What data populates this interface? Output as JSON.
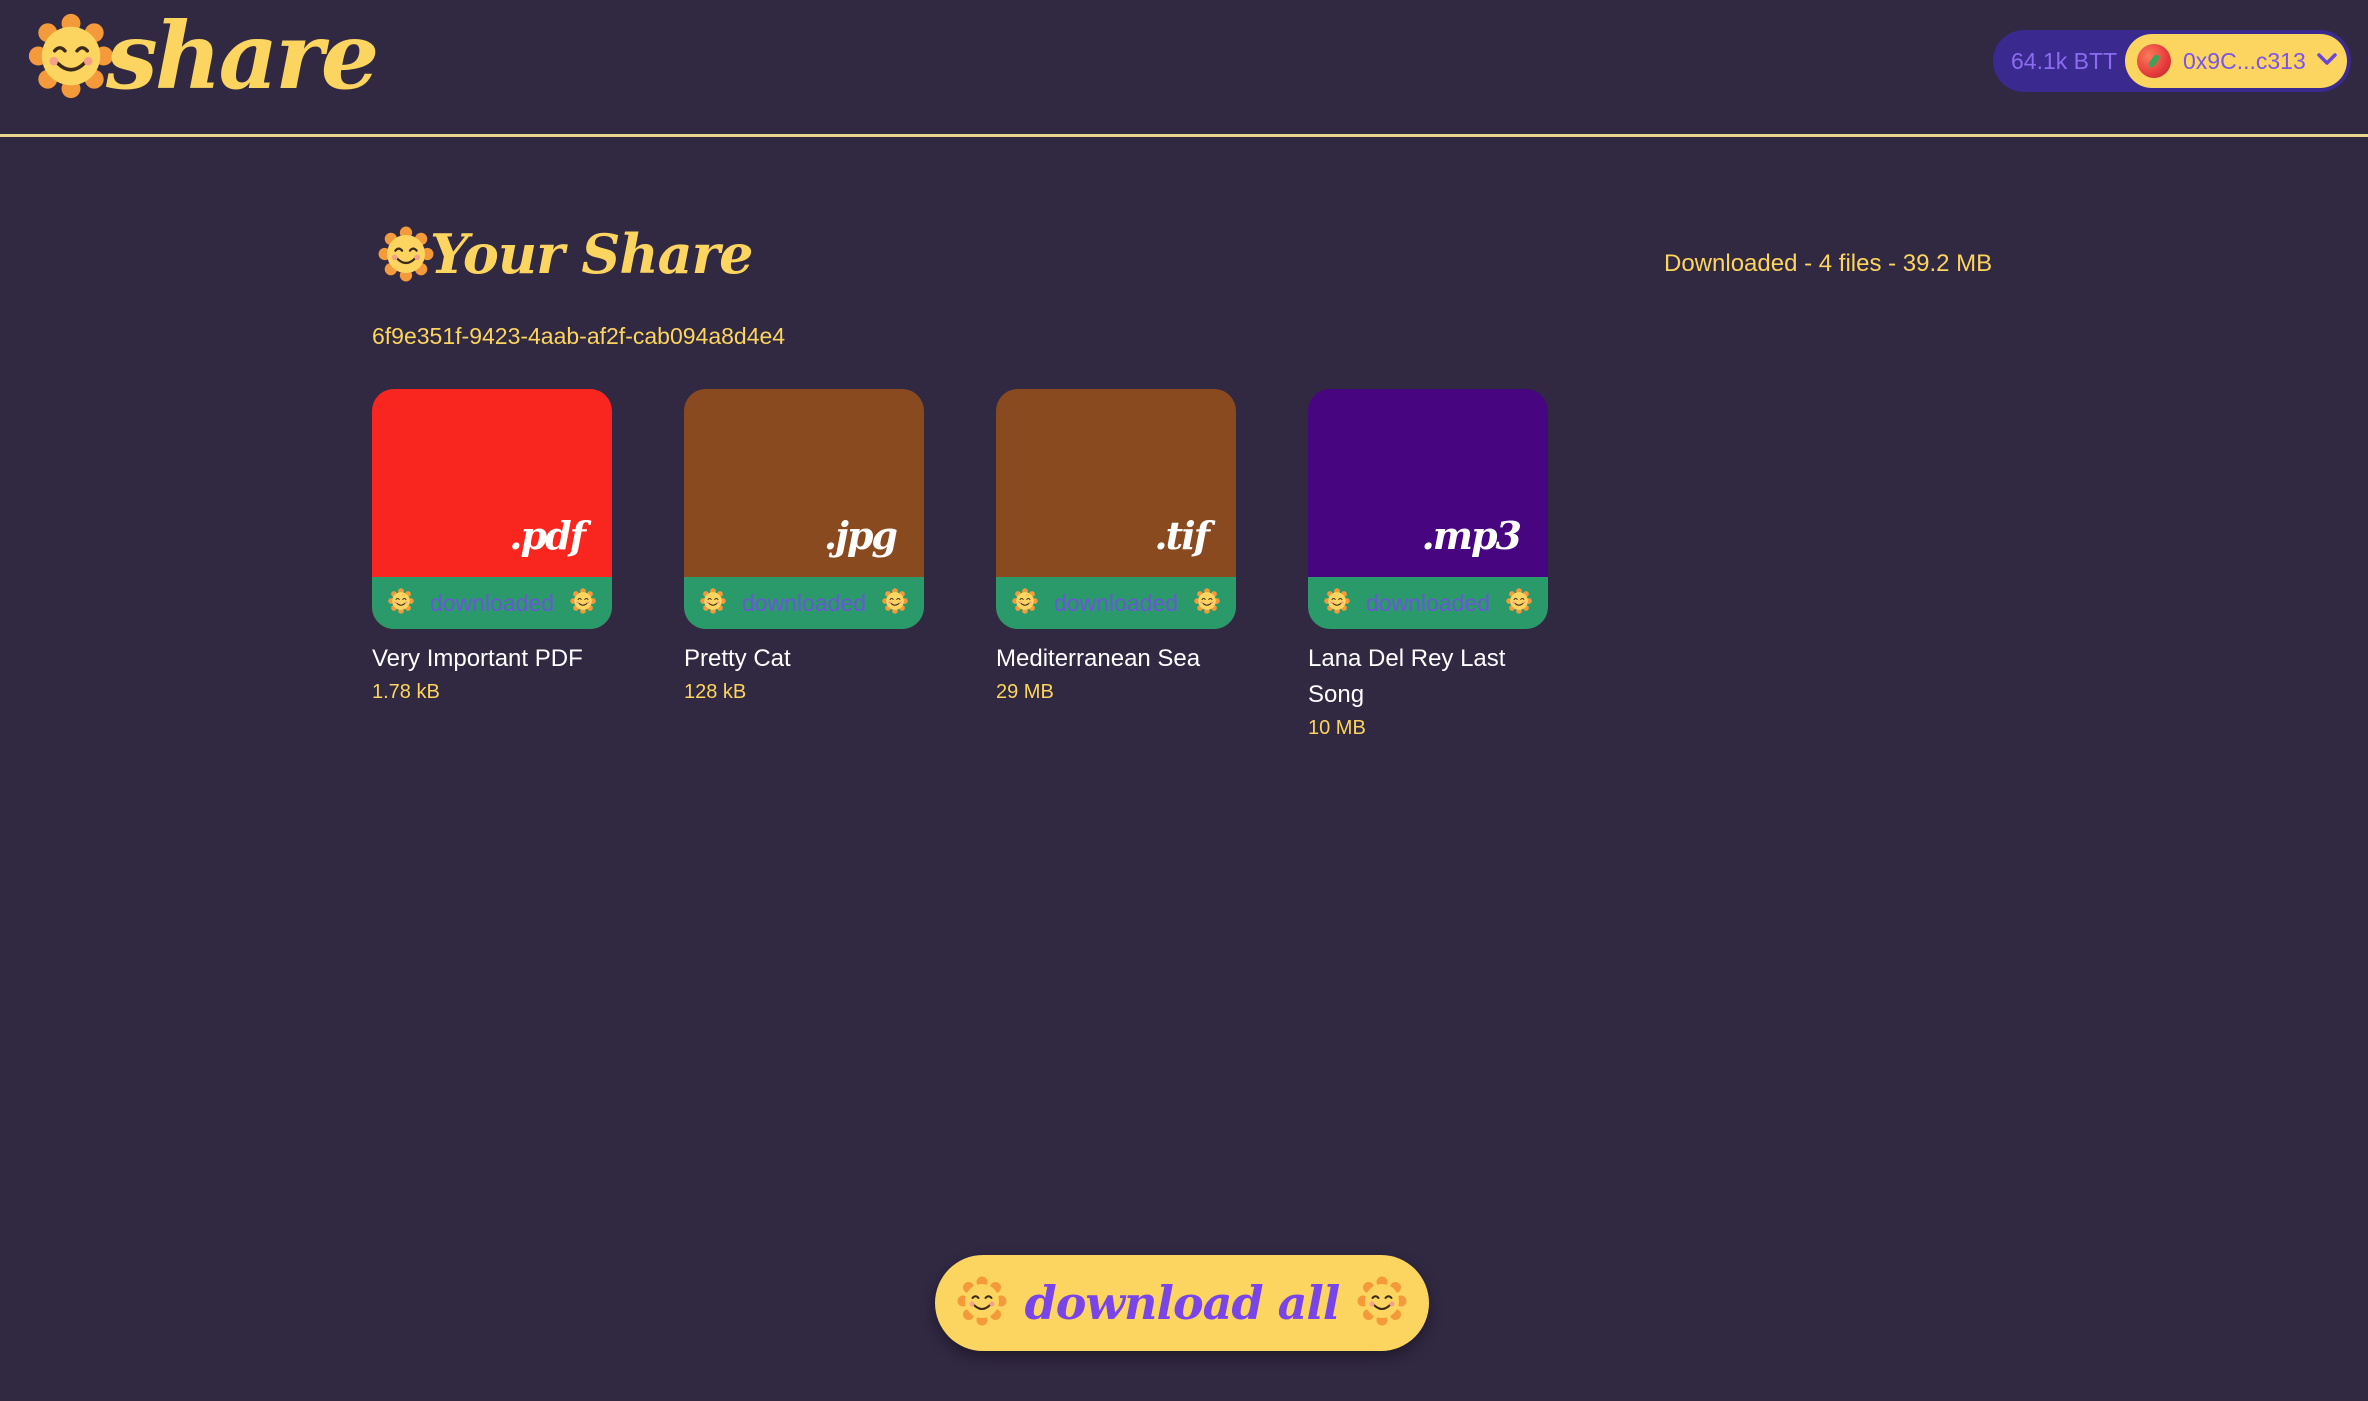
{
  "brand": {
    "name": "share"
  },
  "wallet": {
    "balance": "64.1k BTT",
    "address": "0x9C...c313"
  },
  "page": {
    "title": "Your Share",
    "status": "Downloaded - 4 files - 39.2 MB",
    "share_id": "6f9e351f-9423-4aab-af2f-cab094a8d4e4"
  },
  "files": [
    {
      "ext": ".pdf",
      "color": "#f8261e",
      "status": "downloaded",
      "name": "Very Important PDF",
      "size": "1.78 kB"
    },
    {
      "ext": ".jpg",
      "color": "#8a4a20",
      "status": "downloaded",
      "name": "Pretty Cat",
      "size": "128 kB"
    },
    {
      "ext": ".tif",
      "color": "#8a4a20",
      "status": "downloaded",
      "name": "Mediterranean Sea",
      "size": "29 MB"
    },
    {
      "ext": ".mp3",
      "color": "#47057f",
      "status": "downloaded",
      "name": "Lana Del Rey Last Song",
      "size": "10 MB"
    }
  ],
  "actions": {
    "download_all": "download all"
  },
  "colors": {
    "background": "#312842",
    "accent": "#fbd55f",
    "purple": "#7a45e8",
    "success": "#2a9a6a"
  },
  "icons": {
    "sun": "smiling-sun-icon",
    "chevron": "chevron-down-icon"
  }
}
